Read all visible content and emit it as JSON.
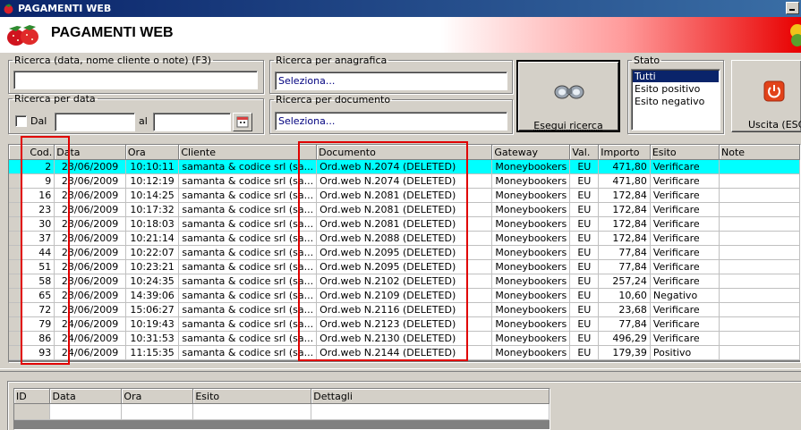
{
  "window": {
    "title": "PAGAMENTI WEB"
  },
  "header": {
    "title": "PAGAMENTI WEB"
  },
  "search": {
    "general_label": "Ricerca (data, nome cliente o note) (F3)",
    "general_value": "",
    "anagrafica_label": "Ricerca per anagrafica",
    "anagrafica_value": "Seleziona...",
    "date_label": "Ricerca per data",
    "date_from_label": "Dal",
    "date_to_label": "al",
    "date_from_value": "",
    "date_to_value": "",
    "documento_label": "Ricerca per documento",
    "documento_value": "Seleziona...",
    "search_button": "Esegui ricerca"
  },
  "stato": {
    "label": "Stato",
    "options": [
      "Tutti",
      "Esito positivo",
      "Esito negativo"
    ],
    "selected": "Tutti"
  },
  "exit_button": "Uscita (ESC)",
  "payments_table": {
    "columns": [
      "Cod.",
      "Data",
      "Ora",
      "Cliente",
      "Documento",
      "Gateway",
      "Val.",
      "Importo",
      "Esito",
      "Note"
    ],
    "rows": [
      [
        "2",
        "23/06/2009",
        "10:10:11",
        "samanta & codice srl (sa...",
        "Ord.web N.2074 (DELETED)",
        "Moneybookers",
        "EU",
        "471,80",
        "Verificare",
        ""
      ],
      [
        "9",
        "23/06/2009",
        "10:12:19",
        "samanta & codice srl (sa...",
        "Ord.web N.2074 (DELETED)",
        "Moneybookers",
        "EU",
        "471,80",
        "Verificare",
        ""
      ],
      [
        "16",
        "23/06/2009",
        "10:14:25",
        "samanta & codice srl (sa...",
        "Ord.web N.2081 (DELETED)",
        "Moneybookers",
        "EU",
        "172,84",
        "Verificare",
        ""
      ],
      [
        "23",
        "23/06/2009",
        "10:17:32",
        "samanta & codice srl (sa...",
        "Ord.web N.2081 (DELETED)",
        "Moneybookers",
        "EU",
        "172,84",
        "Verificare",
        ""
      ],
      [
        "30",
        "23/06/2009",
        "10:18:03",
        "samanta & codice srl (sa...",
        "Ord.web N.2081 (DELETED)",
        "Moneybookers",
        "EU",
        "172,84",
        "Verificare",
        ""
      ],
      [
        "37",
        "23/06/2009",
        "10:21:14",
        "samanta & codice srl (sa...",
        "Ord.web N.2088 (DELETED)",
        "Moneybookers",
        "EU",
        "172,84",
        "Verificare",
        ""
      ],
      [
        "44",
        "23/06/2009",
        "10:22:07",
        "samanta & codice srl (sa...",
        "Ord.web N.2095 (DELETED)",
        "Moneybookers",
        "EU",
        "77,84",
        "Verificare",
        ""
      ],
      [
        "51",
        "23/06/2009",
        "10:23:21",
        "samanta & codice srl (sa...",
        "Ord.web N.2095 (DELETED)",
        "Moneybookers",
        "EU",
        "77,84",
        "Verificare",
        ""
      ],
      [
        "58",
        "23/06/2009",
        "10:24:35",
        "samanta & codice srl (sa...",
        "Ord.web N.2102 (DELETED)",
        "Moneybookers",
        "EU",
        "257,24",
        "Verificare",
        ""
      ],
      [
        "65",
        "23/06/2009",
        "14:39:06",
        "samanta & codice srl (sa...",
        "Ord.web N.2109 (DELETED)",
        "Moneybookers",
        "EU",
        "10,60",
        "Negativo",
        ""
      ],
      [
        "72",
        "23/06/2009",
        "15:06:27",
        "samanta & codice srl (sa...",
        "Ord.web N.2116 (DELETED)",
        "Moneybookers",
        "EU",
        "23,68",
        "Verificare",
        ""
      ],
      [
        "79",
        "24/06/2009",
        "10:19:43",
        "samanta & codice srl (sa...",
        "Ord.web N.2123 (DELETED)",
        "Moneybookers",
        "EU",
        "77,84",
        "Verificare",
        ""
      ],
      [
        "86",
        "24/06/2009",
        "10:31:53",
        "samanta & codice srl (sa...",
        "Ord.web N.2130 (DELETED)",
        "Moneybookers",
        "EU",
        "496,29",
        "Verificare",
        ""
      ],
      [
        "93",
        "24/06/2009",
        "11:15:35",
        "samanta & codice srl (sa...",
        "Ord.web N.2144 (DELETED)",
        "Moneybookers",
        "EU",
        "179,39",
        "Positivo",
        ""
      ]
    ]
  },
  "details_table": {
    "columns": [
      "ID",
      "Data",
      "Ora",
      "Esito",
      "Dettagli"
    ]
  },
  "colors": {
    "titlebar": "#0a246a",
    "highlight_row": "#00ffff",
    "annotation": "#e00000",
    "face": "#d4d0c8"
  },
  "icons": {
    "app": "strawberry-icon",
    "search": "binoculars-icon",
    "exit": "power-icon",
    "calendar": "calendar-icon"
  }
}
